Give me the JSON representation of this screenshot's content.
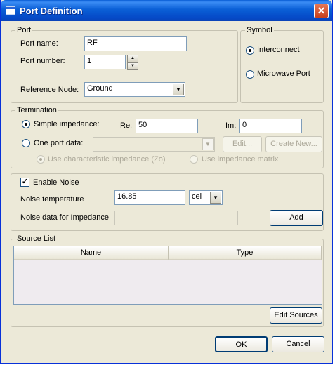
{
  "window": {
    "title": "Port Definition",
    "close_glyph": "✕",
    "icon": "window-icon"
  },
  "port": {
    "legend": "Port",
    "name_label": "Port name:",
    "name_value": "RF",
    "number_label": "Port number:",
    "number_value": "1",
    "spin_up": "▲",
    "spin_down": "▼",
    "refnode_label": "Reference Node:",
    "refnode_value": "Ground"
  },
  "symbol": {
    "legend": "Symbol",
    "interconnect": "Interconnect",
    "microwave": "Microwave Port",
    "selected": "Interconnect"
  },
  "termination": {
    "legend": "Termination",
    "simple_label": "Simple impedance:",
    "re_label": "Re:",
    "re_value": "50",
    "im_label": "Im:",
    "im_value": "0",
    "one_port_label": "One port data:",
    "edit_button": "Edit...",
    "create_new_button": "Create New...",
    "use_char_impedance": "Use characteristic impedance (Zo)",
    "use_impedance_matrix": "Use impedance matrix"
  },
  "noise": {
    "enable_label": "Enable Noise",
    "enabled": true,
    "check_glyph": "✓",
    "temperature_label": "Noise temperature",
    "temperature_value": "16.85",
    "unit_value": "cel",
    "data_label": "Noise data for Impedance",
    "data_value": "",
    "add_button": "Add"
  },
  "source_list": {
    "legend": "Source List",
    "columns": [
      "Name",
      "Type"
    ],
    "edit_button": "Edit Sources"
  },
  "footer": {
    "ok_button": "OK",
    "cancel_button": "Cancel"
  },
  "dropdown_glyph": "▼",
  "colors": {
    "title_bar": "#0a5fd6",
    "dialog_bg": "#ece9d8",
    "close_button": "#c8401c",
    "group_border": "#c5c2b2"
  }
}
